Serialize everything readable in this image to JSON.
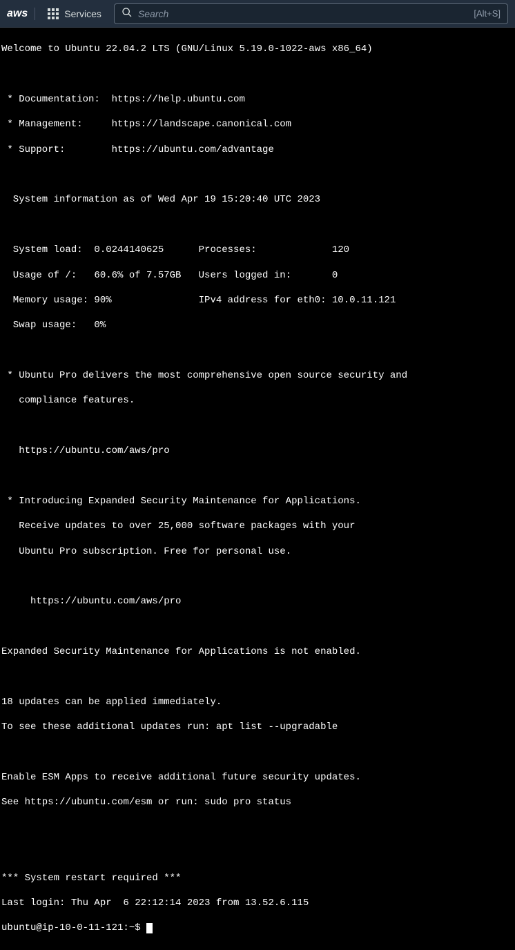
{
  "navbar": {
    "logo_text": "aws",
    "services_label": "Services",
    "search_placeholder": "Search",
    "shortcut_label": "[Alt+S]"
  },
  "terminal": {
    "welcome": "Welcome to Ubuntu 22.04.2 LTS (GNU/Linux 5.19.0-1022-aws x86_64)",
    "doc_label": " * Documentation:  https://help.ubuntu.com",
    "mgmt_label": " * Management:     https://landscape.canonical.com",
    "support_label": " * Support:        https://ubuntu.com/advantage",
    "sysinfo_header": "  System information as of Wed Apr 19 15:20:40 UTC 2023",
    "row1": "  System load:  0.0244140625      Processes:             120",
    "row2": "  Usage of /:   60.6% of 7.57GB   Users logged in:       0",
    "row3": "  Memory usage: 90%               IPv4 address for eth0: 10.0.11.121",
    "row4": "  Swap usage:   0%",
    "pro1": " * Ubuntu Pro delivers the most comprehensive open source security and",
    "pro2": "   compliance features.",
    "pro_url": "   https://ubuntu.com/aws/pro",
    "esm1": " * Introducing Expanded Security Maintenance for Applications.",
    "esm2": "   Receive updates to over 25,000 software packages with your",
    "esm3": "   Ubuntu Pro subscription. Free for personal use.",
    "esm_url": "     https://ubuntu.com/aws/pro",
    "esm_disabled": "Expanded Security Maintenance for Applications is not enabled.",
    "updates1": "18 updates can be applied immediately.",
    "updates2": "To see these additional updates run: apt list --upgradable",
    "enable1": "Enable ESM Apps to receive additional future security updates.",
    "enable2": "See https://ubuntu.com/esm or run: sudo pro status",
    "restart": "*** System restart required ***",
    "last_login": "Last login: Thu Apr  6 22:12:14 2023 from 13.52.6.115",
    "prompt": "ubuntu@ip-10-0-11-121:~$ "
  }
}
